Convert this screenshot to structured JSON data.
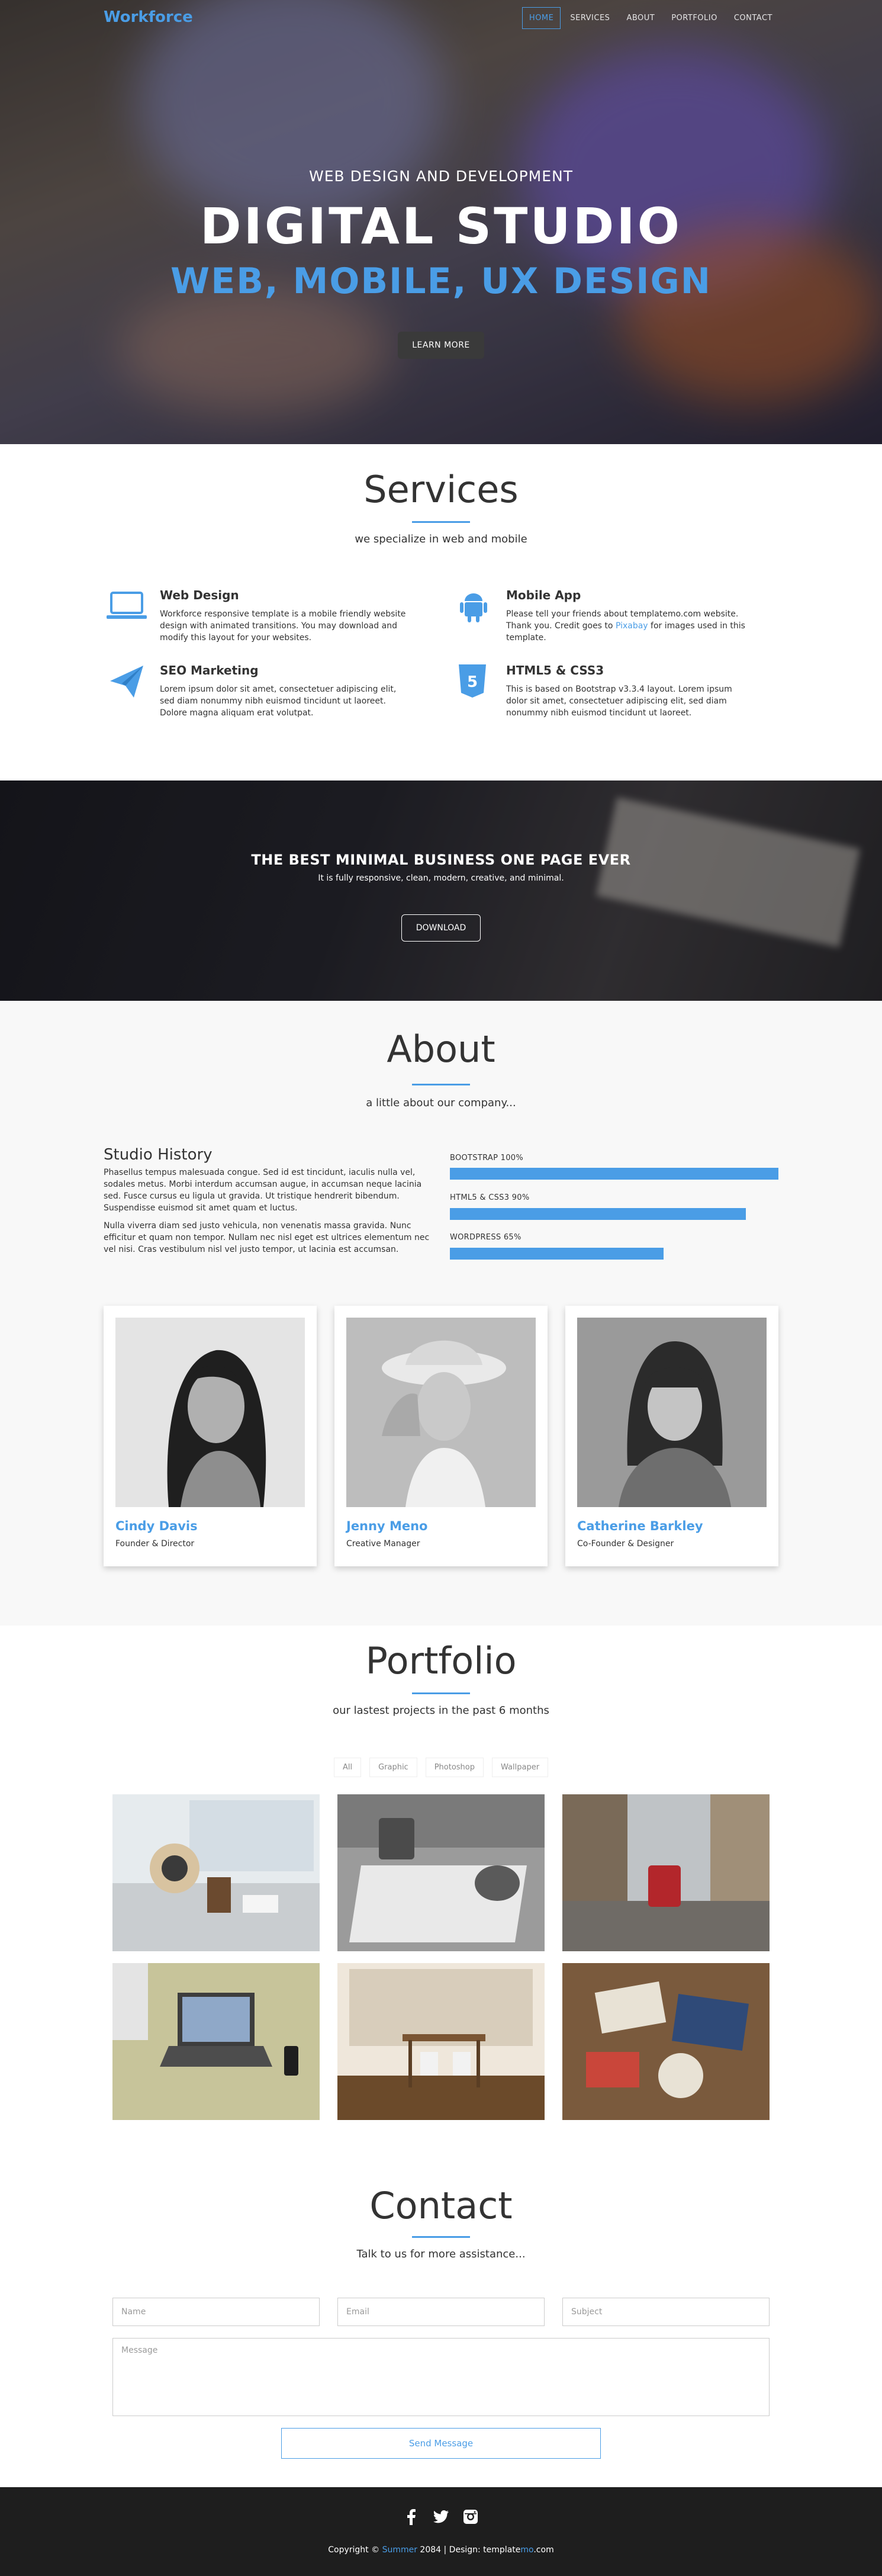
{
  "nav": {
    "brand": "Workforce",
    "items": [
      {
        "label": "HOME"
      },
      {
        "label": "SERVICES"
      },
      {
        "label": "ABOUT"
      },
      {
        "label": "PORTFOLIO"
      },
      {
        "label": "CONTACT"
      }
    ]
  },
  "hero": {
    "subtitle": "WEB DESIGN AND DEVELOPMENT",
    "title": "DIGITAL STUDIO",
    "title2": "WEB, MOBILE, UX DESIGN",
    "button": "LEARN MORE"
  },
  "services": {
    "title": "Services",
    "subtitle": "we specialize in web and mobile",
    "items": [
      {
        "icon": "laptop-icon",
        "title": "Web Design",
        "text": "Workforce responsive template is a mobile friendly website design with animated transitions. You may download and modify this layout for your websites."
      },
      {
        "icon": "android-icon",
        "title": "Mobile App",
        "text_before": "Please tell your friends about templatemo.com website. Thank you. Credit goes to ",
        "link": "Pixabay",
        "text_after": " for images used in this template."
      },
      {
        "icon": "paper-plane-icon",
        "title": "SEO Marketing",
        "text": "Lorem ipsum dolor sit amet, consectetuer adipiscing elit, sed diam nonummy nibh euismod tincidunt ut laoreet. Dolore magna aliquam erat volutpat."
      },
      {
        "icon": "html5-icon",
        "title": "HTML5 & CSS3",
        "text": "This is based on Bootstrap v3.3.4 layout. Lorem ipsum dolor sit amet, consectetuer adipiscing elit, sed diam nonummy nibh euismod tincidunt ut laoreet."
      }
    ]
  },
  "banner": {
    "title": "THE BEST MINIMAL BUSINESS ONE PAGE EVER",
    "text": "It is fully responsive, clean, modern, creative, and minimal.",
    "button": "DOWNLOAD"
  },
  "about": {
    "title": "About",
    "subtitle": "a little about our company...",
    "history_title": "Studio History",
    "p1": "Phasellus tempus malesuada congue. Sed id est tincidunt, iaculis nulla vel, sodales metus. Morbi interdum accumsan augue, in accumsan neque lacinia sed. Fusce cursus eu ligula ut gravida. Ut tristique hendrerit bibendum. Suspendisse euismod sit amet quam et luctus.",
    "p2": "Nulla viverra diam sed justo vehicula, non venenatis massa gravida. Nunc efficitur et quam non tempor. Nullam nec nisl eget est ultrices elementum nec vel nisi. Cras vestibulum nisl vel justo tempor, ut lacinia est accumsan.",
    "skills": [
      {
        "label": "BOOTSTRAP 100%",
        "percent": 100
      },
      {
        "label": "HTML5 & CSS3 90%",
        "percent": 90
      },
      {
        "label": "WORDPRESS 65%",
        "percent": 65
      }
    ],
    "team": [
      {
        "name": "Cindy Davis",
        "role": "Founder & Director"
      },
      {
        "name": "Jenny Meno",
        "role": "Creative Manager"
      },
      {
        "name": "Catherine Barkley",
        "role": "Co-Founder & Designer"
      }
    ]
  },
  "portfolio": {
    "title": "Portfolio",
    "subtitle": "our lastest projects in the past 6 months",
    "filters": [
      "All",
      "Graphic",
      "Photoshop",
      "Wallpaper"
    ]
  },
  "contact": {
    "title": "Contact",
    "subtitle": "Talk to us for more assistance...",
    "name_placeholder": "Name",
    "email_placeholder": "Email",
    "subject_placeholder": "Subject",
    "message_placeholder": "Message",
    "send": "Send Message"
  },
  "footer": {
    "copy_prefix": "Copyright © ",
    "company": "Summer",
    "copy_middle": " 2084 | Design: template",
    "mo": "mo",
    "copy_suffix": ".com",
    "social": [
      "facebook-icon",
      "twitter-icon",
      "instagram-icon"
    ]
  },
  "colors": {
    "accent": "#4a9de6",
    "dark": "#333333",
    "footer": "#1e1e1e"
  }
}
